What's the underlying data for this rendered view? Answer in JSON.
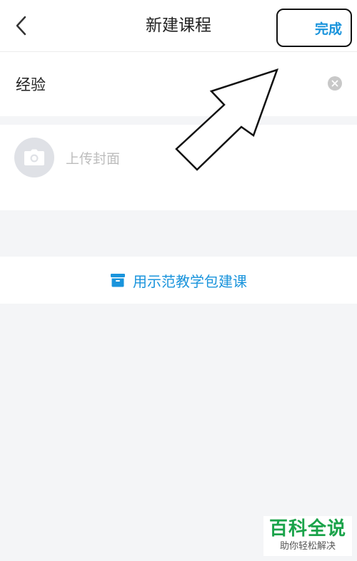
{
  "header": {
    "title": "新建课程",
    "done_label": "完成"
  },
  "course_form": {
    "name_value": "经验",
    "cover_label": "上传封面"
  },
  "template_action": {
    "label": "用示范教学包建课"
  },
  "watermark": {
    "title": "百科全说",
    "subtitle": "助你轻松解决"
  },
  "colors": {
    "accent": "#1a94dc",
    "background": "#f4f5f7",
    "watermark_green": "#1aa34a"
  },
  "icons": {
    "back": "chevron-left-icon",
    "clear": "clear-icon",
    "camera": "camera-icon",
    "template": "box-icon"
  }
}
